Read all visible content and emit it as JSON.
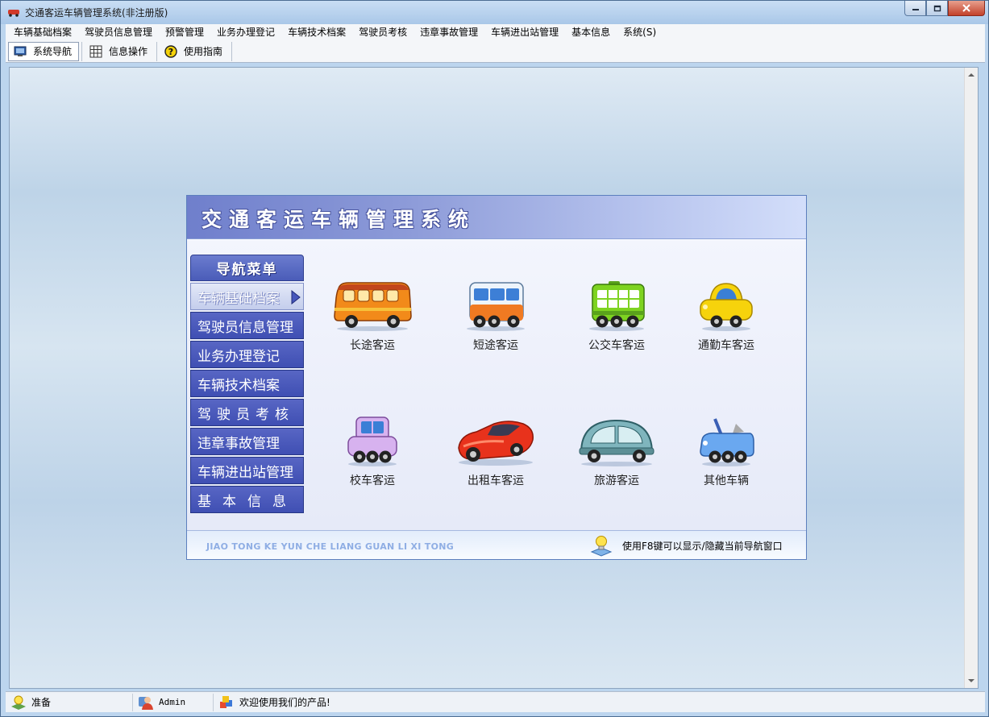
{
  "window": {
    "title": "交通客运车辆管理系统(非注册版)"
  },
  "menubar": {
    "items": [
      "车辆基础档案",
      "驾驶员信息管理",
      "预警管理",
      "业务办理登记",
      "车辆技术档案",
      "驾驶员考核",
      "违章事故管理",
      "车辆进出站管理",
      "基本信息",
      "系统(S)"
    ]
  },
  "toolbar": {
    "items": [
      "系统导航",
      "信息操作",
      "使用指南"
    ]
  },
  "nav": {
    "title": "交通客运车辆管理系统",
    "menu_header": "导航菜单",
    "menu_items": [
      "车辆基础档案",
      "驾驶员信息管理",
      "业务办理登记",
      "车辆技术档案",
      "驾驶员考核",
      "违章事故管理",
      "车辆进出站管理",
      "基本信息"
    ],
    "vehicles": [
      "长途客运",
      "短途客运",
      "公交车客运",
      "通勤车客运",
      "校车客运",
      "出租车客运",
      "旅游客运",
      "其他车辆"
    ],
    "footer_pinyin": "JIAO TONG KE YUN CHE LIANG GUAN LI XI TONG",
    "footer_hint": "使用F8键可以显示/隐藏当前导航窗口"
  },
  "status": {
    "ready": "准备",
    "user": "Admin",
    "welcome": "欢迎使用我们的产品!"
  },
  "colors": {
    "menu_button": "#4656bb",
    "header_gradient_start": "#6f7fcc",
    "footer_pinyin": "#8faee4"
  }
}
